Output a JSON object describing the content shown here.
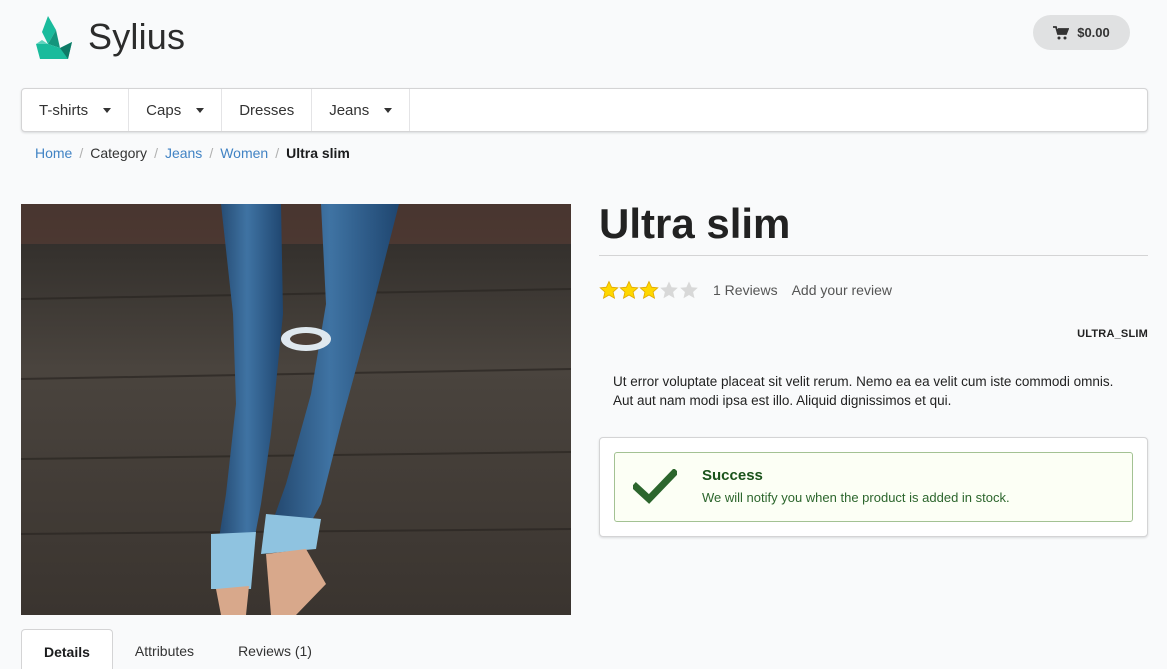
{
  "brand": {
    "name": "Sylius",
    "logo_color": "#1abb9c"
  },
  "cart": {
    "total": "$0.00",
    "icon": "cart-icon"
  },
  "menu": {
    "items": [
      {
        "label": "T-shirts",
        "has_dropdown": true
      },
      {
        "label": "Caps",
        "has_dropdown": true
      },
      {
        "label": "Dresses",
        "has_dropdown": false
      },
      {
        "label": "Jeans",
        "has_dropdown": true
      }
    ]
  },
  "breadcrumb": {
    "home": "Home",
    "category": "Category",
    "jeans": "Jeans",
    "women": "Women",
    "current": "Ultra slim",
    "separator": "/"
  },
  "product": {
    "name": "Ultra slim",
    "code": "ULTRA_SLIM",
    "rating": 3,
    "rating_max": 5,
    "reviews_label": "1 Reviews",
    "add_review_label": "Add your review",
    "description": "Ut error voluptate placeat sit velit rerum. Nemo ea ea velit cum iste commodi omnis. Aut aut nam modi ipsa est illo. Aliquid dignissimos et qui."
  },
  "message": {
    "title": "Success",
    "text": "We will notify you when the product is added in stock.",
    "icon": "checkmark-icon",
    "color": "#2c662d"
  },
  "tabs": [
    {
      "label": "Details",
      "active": true
    },
    {
      "label": "Attributes",
      "active": false
    },
    {
      "label": "Reviews (1)",
      "active": false
    }
  ],
  "colors": {
    "link": "#4183c4",
    "star_active": "#ffd700",
    "star_inactive": "#d8d8d8"
  }
}
